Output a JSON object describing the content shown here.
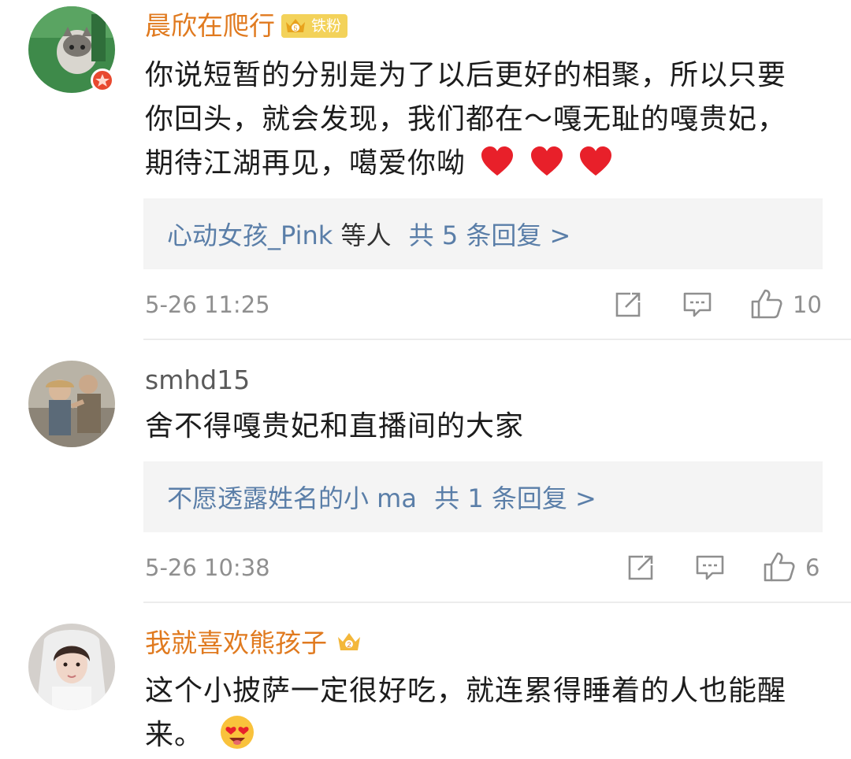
{
  "comments": [
    {
      "username": "晨欣在爬行",
      "fan_badge": "铁粉",
      "badge_level": "5",
      "text": "你说短暂的分别是为了以后更好的相聚，所以只要你回头，就会发现，我们都在～嘎无耻的嘎贵妃，期待江湖再见，噶爱你呦",
      "reply_users": "心动女孩_Pink",
      "reply_mid": "等人",
      "reply_count": "共 5 条回复 >",
      "time": "5-26 11:25",
      "likes": "10"
    },
    {
      "username": "smhd15",
      "text": "舍不得嘎贵妃和直播间的大家",
      "reply_users": "不愿透露姓名的小 ma",
      "reply_count": "共 1 条回复 >",
      "time": "5-26 10:38",
      "likes": "6"
    },
    {
      "username": "我就喜欢熊孩子",
      "badge_level": "2",
      "text": "这个小披萨一定很好吃，就连累得睡着的人也能醒来。"
    }
  ],
  "colors": {
    "vip_name": "#e07a1f",
    "link_blue": "#5a7ea8",
    "reply_bg": "#f4f4f4",
    "meta_gray": "#8f8f8f"
  },
  "icons": [
    "share-icon",
    "comment-icon",
    "like-icon",
    "crown-badge-icon",
    "heart-emoji-icon",
    "heart-eyes-emoji-icon"
  ]
}
